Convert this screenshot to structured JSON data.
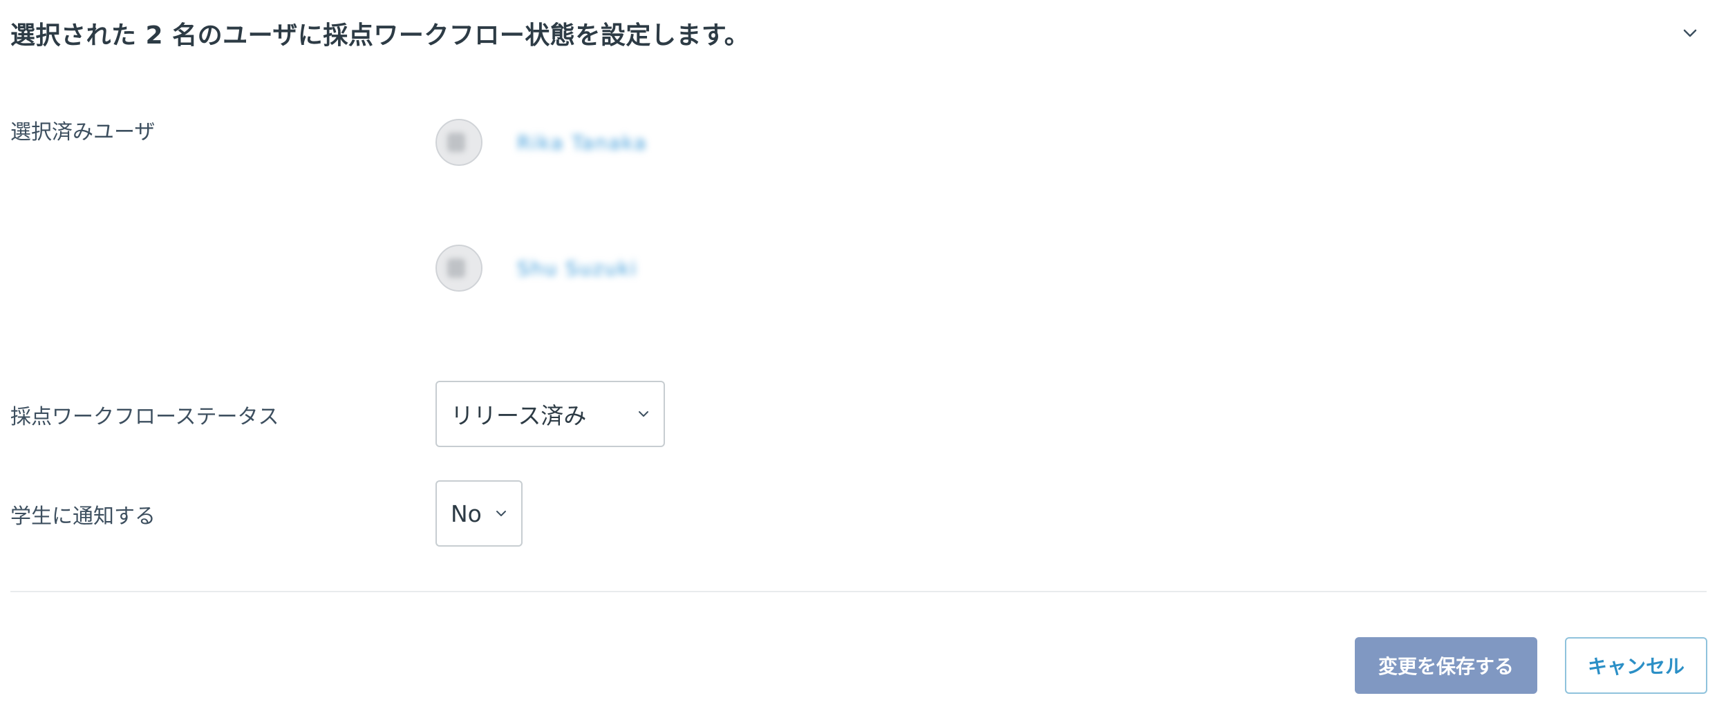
{
  "header": {
    "title": "選択された 2 名のユーザに採点ワークフロー状態を設定します。",
    "collapse_icon": "chevron-down-icon"
  },
  "selected_users": {
    "label": "選択済みユーザ",
    "users": [
      {
        "initials": "RK",
        "name": "Rika Tanaka"
      },
      {
        "initials": "SS",
        "name": "Shu Suzuki"
      }
    ]
  },
  "workflow_status": {
    "label": "採点ワークフローステータス",
    "selected": "リリース済み"
  },
  "notify_students": {
    "label": "学生に通知する",
    "selected": "No"
  },
  "actions": {
    "save_label": "変更を保存する",
    "cancel_label": "キャンセル"
  },
  "colors": {
    "save_button_bg": "#8098c2",
    "cancel_button_text": "#2b8fc6",
    "user_link": "#3b9ad9",
    "text": "#3d4f5f"
  }
}
